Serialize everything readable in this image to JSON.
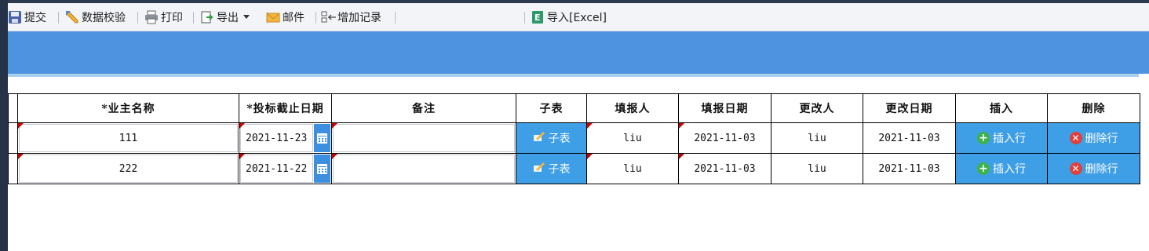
{
  "toolbar": {
    "submit": "提交",
    "validate": "数据校验",
    "print": "打印",
    "export": "导出",
    "mail": "邮件",
    "add_record": "增加记录",
    "import_excel": "导入[Excel]"
  },
  "table": {
    "headers": {
      "owner_name": "*业主名称",
      "deadline": "*投标截止日期",
      "remark": "备注",
      "subtable": "子表",
      "filler": "填报人",
      "fill_date": "填报日期",
      "modifier": "更改人",
      "modify_date": "更改日期",
      "insert": "插入",
      "delete": "删除"
    },
    "rows": [
      {
        "owner_name": "111",
        "deadline": "2021-11-23",
        "remark": "",
        "subtable": "子表",
        "filler": "liu",
        "fill_date": "2021-11-03",
        "modifier": "liu",
        "modify_date": "2021-11-03",
        "insert": "插入行",
        "delete": "删除行"
      },
      {
        "owner_name": "222",
        "deadline": "2021-11-22",
        "remark": "",
        "subtable": "子表",
        "filler": "liu",
        "fill_date": "2021-11-03",
        "modifier": "liu",
        "modify_date": "2021-11-03",
        "insert": "插入行",
        "delete": "删除行"
      }
    ]
  },
  "icons": {
    "submit": "save-icon",
    "validate": "pencil-icon",
    "print": "printer-icon",
    "export": "export-icon",
    "mail": "envelope-icon",
    "add_record": "add-record-icon",
    "import_excel": "excel-icon"
  },
  "colors": {
    "banner": "#4d93e0",
    "button": "#3e9fe7",
    "required_mark": "#c80000",
    "add": "#3bb24a",
    "delete": "#e0413c"
  }
}
